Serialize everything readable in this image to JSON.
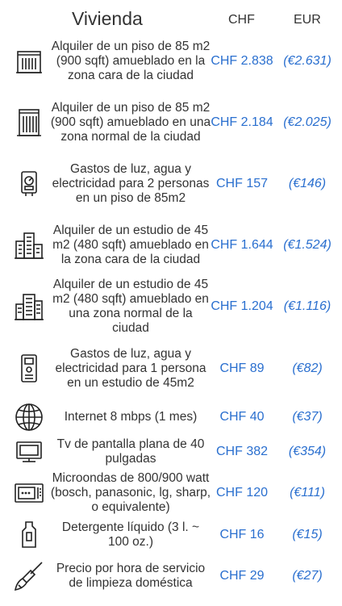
{
  "header": {
    "title": "Vivienda",
    "col_chf": "CHF",
    "col_eur": "EUR"
  },
  "rows": [
    {
      "icon": "apartment-building-icon",
      "desc": "Alquiler de un piso de 85 m2 (900 sqft) amueblado en la zona cara de la ciudad",
      "chf": "CHF 2.838",
      "eur": "(€2.631)"
    },
    {
      "icon": "apartment-building-icon",
      "desc": "Alquiler de un piso de 85 m2 (900 sqft) amueblado en una zona normal de la ciudad",
      "chf": "CHF 2.184",
      "eur": "(€2.025)"
    },
    {
      "icon": "utility-meter-icon",
      "desc": "Gastos de luz, agua y electricidad para 2 personas en un piso de 85m2",
      "chf": "CHF 157",
      "eur": "(€146)"
    },
    {
      "icon": "city-buildings-icon",
      "desc": "Alquiler de un estudio de 45 m2 (480 sqft) amueblado en la zona cara de la ciudad",
      "chf": "CHF 1.644",
      "eur": "(€1.524)"
    },
    {
      "icon": "city-buildings-icon",
      "desc": "Alquiler de un estudio de 45 m2 (480 sqft) amueblado en una zona normal de la ciudad",
      "chf": "CHF 1.204",
      "eur": "(€1.116)"
    },
    {
      "icon": "utility-meter-icon",
      "desc": "Gastos de luz, agua y electricidad para 1 persona en un estudio de 45m2",
      "chf": "CHF 89",
      "eur": "(€82)"
    },
    {
      "icon": "globe-icon",
      "desc": "Internet 8 mbps (1 mes)",
      "chf": "CHF 40",
      "eur": "(€37)"
    },
    {
      "icon": "tv-icon",
      "desc": "Tv de pantalla plana de 40 pulgadas",
      "chf": "CHF 382",
      "eur": "(€354)"
    },
    {
      "icon": "microwave-icon",
      "desc": "Microondas de 800/900 watt (bosch, panasonic, lg, sharp, o equivalente)",
      "chf": "CHF 120",
      "eur": "(€111)"
    },
    {
      "icon": "detergent-bottle-icon",
      "desc": "Detergente líquido (3 l. ~ 100 oz.)",
      "chf": "CHF 16",
      "eur": "(€15)"
    },
    {
      "icon": "broom-icon",
      "desc": "Precio por hora de servicio de limpieza doméstica",
      "chf": "CHF 29",
      "eur": "(€27)"
    }
  ]
}
